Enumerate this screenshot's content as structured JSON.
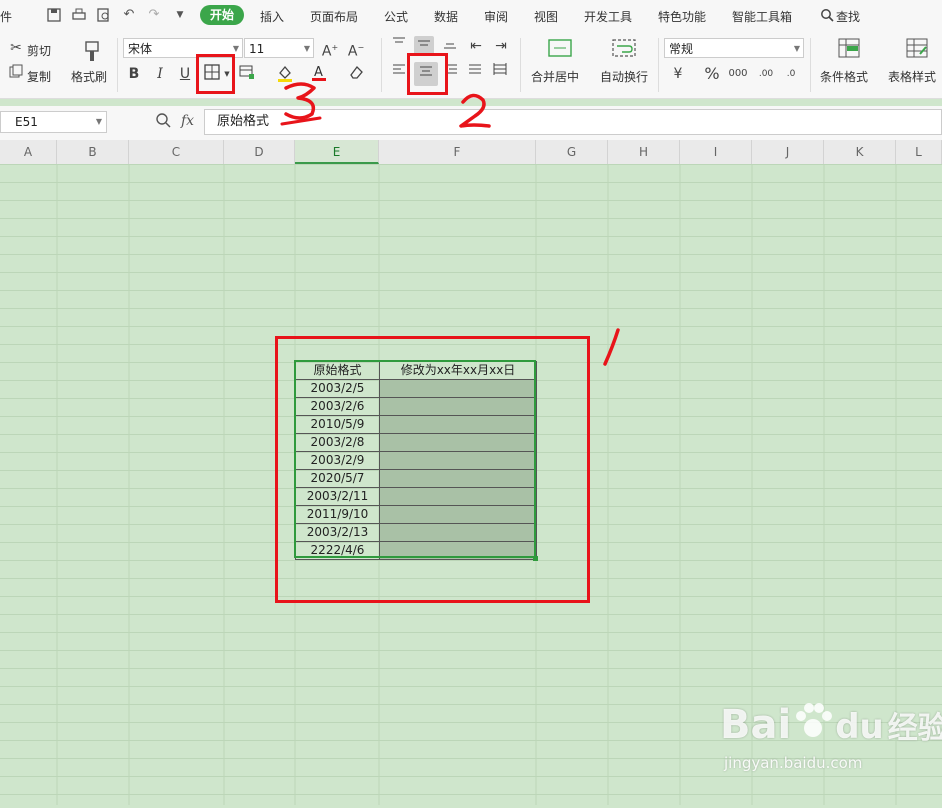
{
  "menu": {
    "file_fragment": "件",
    "active_tab": "开始",
    "tabs": [
      "插入",
      "页面布局",
      "公式",
      "数据",
      "审阅",
      "视图",
      "开发工具",
      "特色功能",
      "智能工具箱"
    ],
    "search_label": "查找"
  },
  "ribbon": {
    "cut_label": "剪切",
    "copy_label": "复制",
    "format_painter_label": "格式刷",
    "font_name": "宋体",
    "font_size": "11",
    "bold_label": "B",
    "italic_label": "I",
    "underline_label": "U",
    "merge_center_label": "合并居中",
    "wrap_text_label": "自动换行",
    "number_format": "常规",
    "conditional_format_label": "条件格式",
    "table_style_label": "表格样式"
  },
  "formula_bar": {
    "name_box": "E51",
    "fx_label": "fx",
    "value": "原始格式"
  },
  "columns": [
    "A",
    "B",
    "C",
    "D",
    "E",
    "F",
    "G",
    "H",
    "I",
    "J",
    "K",
    "L"
  ],
  "table": {
    "headers": [
      "原始格式",
      "修改为xx年xx月xx日"
    ],
    "rows": [
      "2003/2/5",
      "2003/2/6",
      "2010/5/9",
      "2003/2/8",
      "2003/2/9",
      "2020/5/7",
      "2003/2/11",
      "2011/9/10",
      "2003/2/13",
      "2222/4/6"
    ]
  },
  "annotations": [
    "1",
    "2",
    "3"
  ],
  "colors": {
    "accent_green": "#3ba64a",
    "sheet_background": "#cfe6cc",
    "annotation_red": "#e8141a",
    "selection_border": "#2f9a3d"
  },
  "watermark": {
    "brand": "Bai",
    "brand_suffix": "du",
    "product": "经验",
    "url": "jingyan.baidu.com"
  }
}
